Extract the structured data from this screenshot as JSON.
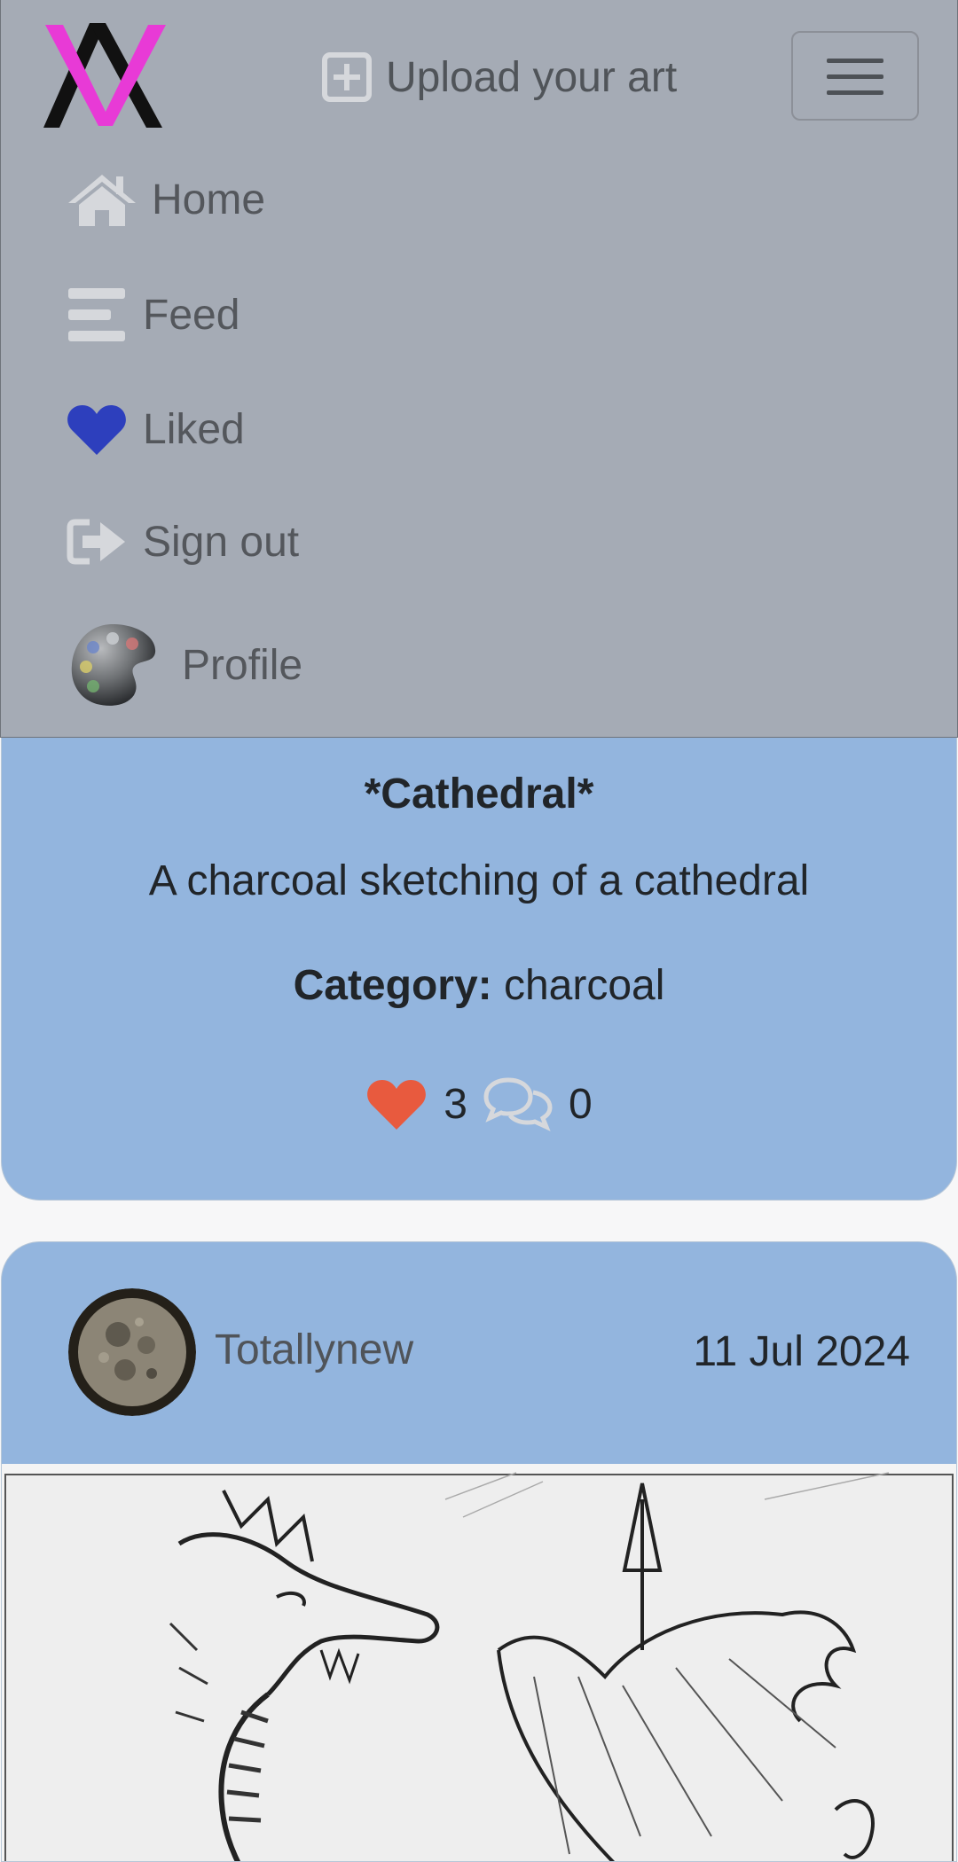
{
  "navbar": {
    "logo_text": "AV",
    "upload_label": "Upload your art",
    "menu": [
      {
        "label": "Home",
        "icon": "home-icon"
      },
      {
        "label": "Feed",
        "icon": "feed-icon"
      },
      {
        "label": "Liked",
        "icon": "heart-icon"
      },
      {
        "label": "Sign out",
        "icon": "sign-out-icon"
      },
      {
        "label": "Profile",
        "icon": "palette-avatar"
      }
    ]
  },
  "post1": {
    "title": "*Cathedral*",
    "description": "A charcoal sketching of a cathedral",
    "category_label": "Category:",
    "category_value": "charcoal",
    "likes": "3",
    "comments": "0"
  },
  "post2": {
    "author": "Totallynew",
    "date": "11 Jul 2024"
  },
  "colors": {
    "navbar_bg": "#a5abb5",
    "card_bg": "#93b5de",
    "heart_blue": "#2d3fbd",
    "heart_red": "#e85a3e",
    "logo_magenta": "#e83ad6"
  }
}
